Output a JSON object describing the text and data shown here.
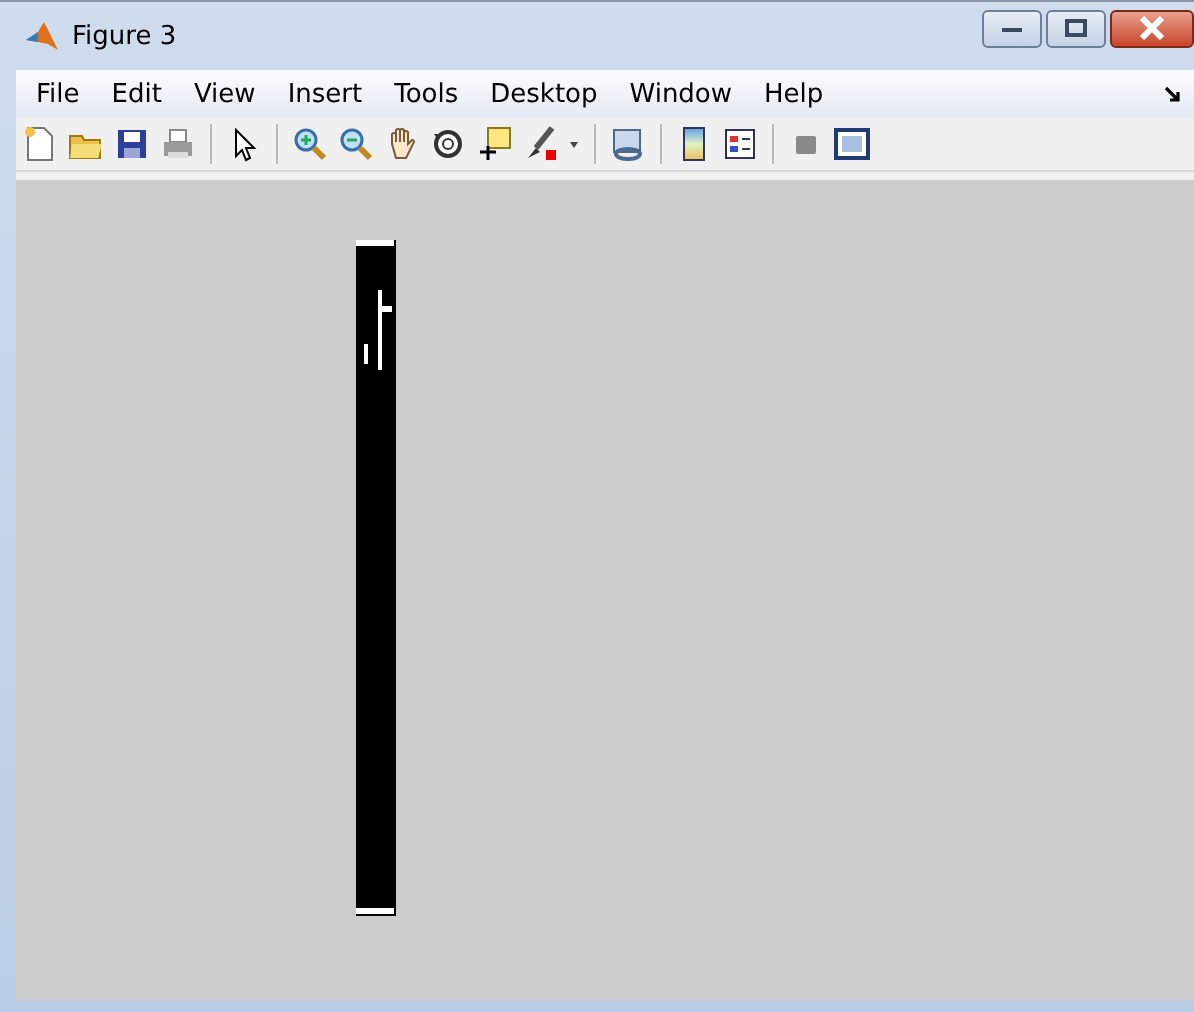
{
  "window": {
    "title": "Figure 3"
  },
  "menu": [
    {
      "label": "File"
    },
    {
      "label": "Edit"
    },
    {
      "label": "View"
    },
    {
      "label": "Insert"
    },
    {
      "label": "Tools"
    },
    {
      "label": "Desktop"
    },
    {
      "label": "Window"
    },
    {
      "label": "Help"
    }
  ]
}
